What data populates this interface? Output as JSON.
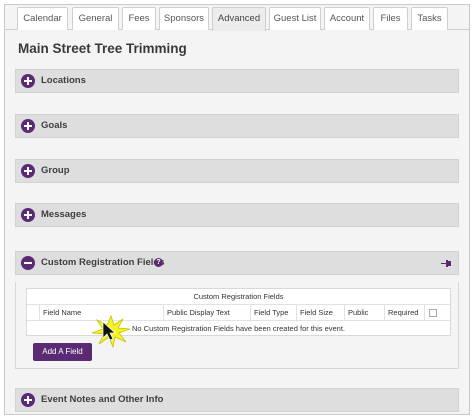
{
  "tabs": [
    {
      "label": "Calendar",
      "active": false
    },
    {
      "label": "General",
      "active": false
    },
    {
      "label": "Fees",
      "active": false
    },
    {
      "label": "Sponsors",
      "active": false
    },
    {
      "label": "Advanced",
      "active": true
    },
    {
      "label": "Guest List",
      "active": false
    },
    {
      "label": "Account",
      "active": false
    },
    {
      "label": "Files",
      "active": false
    },
    {
      "label": "Tasks",
      "active": false
    }
  ],
  "page_title": "Main Street Tree Trimming",
  "sections": [
    {
      "label": "Locations",
      "expanded": false
    },
    {
      "label": "Goals",
      "expanded": false
    },
    {
      "label": "Group",
      "expanded": false
    },
    {
      "label": "Messages",
      "expanded": false
    },
    {
      "label": "Custom Registration Fields",
      "expanded": true
    },
    {
      "label": "Event Notes and Other Info",
      "expanded": false
    }
  ],
  "custom_fields": {
    "caption": "Custom Registration Fields",
    "columns": [
      "Field Name",
      "Public Display Text",
      "Field Type",
      "Field Size",
      "Public",
      "Required"
    ],
    "empty_message": "No Custom Registration Fields have been created for this event.",
    "add_button_label": "Add A Field",
    "help_glyph": "?"
  },
  "colors": {
    "accent": "#5b2a74",
    "section_bg": "#dedede",
    "page_bg": "#f4f4f4"
  },
  "icons": {
    "expand": "plus-circle-icon",
    "collapse": "minus-circle-icon",
    "help": "help-icon",
    "pin": "pin-icon",
    "cursor": "cursor-click-icon"
  }
}
